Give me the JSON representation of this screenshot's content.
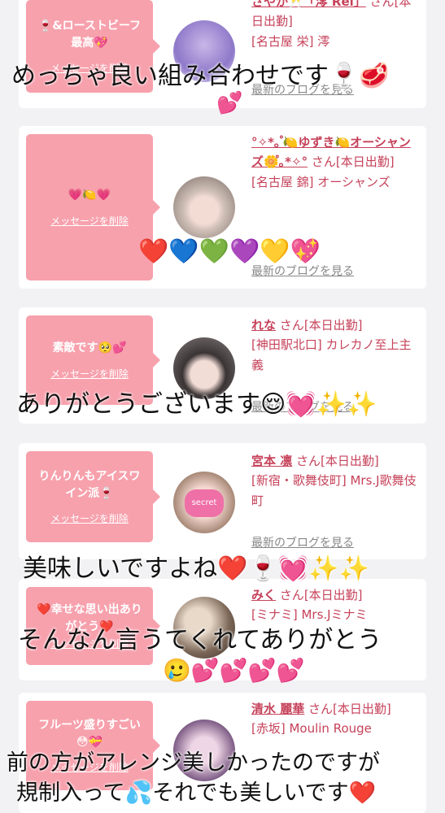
{
  "cards": [
    {
      "message": "🍷&ローストビーフ最高💖",
      "delete_label": "メッセージを削除",
      "name": "さやか🥂「澪 Rei」",
      "san": "さん",
      "status": "[本日出勤]",
      "shop": "[名古屋 栄] 澪",
      "blog_label": "最新のブログを見る"
    },
    {
      "message": "💗🍋💗",
      "delete_label": "メッセージを削除",
      "name": "°✧*｡ ゚🍋ゆずき🍋オーシャンズ🌼゚｡*✧°",
      "san": "さん",
      "status": "[本日出勤]",
      "shop": "[名古屋 錦] オーシャンズ",
      "blog_label": "最新のブログを見る"
    },
    {
      "message": "素敵です🥺💕",
      "delete_label": "メッセージを削除",
      "name": "れな",
      "san": "さん",
      "status": "[本日出勤]",
      "shop": "[神田駅北口] カレカノ至上主義",
      "blog_label": "最新のブログを見る"
    },
    {
      "message": "りんりんもアイスワイン派🍷",
      "delete_label": "メッセージを削除",
      "name": "宮本 凛",
      "san": "さん",
      "status": "[本日出勤]",
      "shop": "[新宿・歌舞伎町] Mrs.J歌舞伎町",
      "avatar_text": "secret",
      "blog_label": "最新のブログを見る"
    },
    {
      "message": "❤️幸せな思い出ありがとう❤️",
      "delete_label": "メッセージを削除",
      "name": "みく",
      "san": "さん",
      "status": "[本日出勤]",
      "shop": "[ミナミ] Mrs.Jミナミ",
      "blog_label": "最新のブログを見る"
    },
    {
      "message": "フルーツ盛りすごい😳💝",
      "delete_label": "メッセージを削除",
      "name": "清水 麗華",
      "san": "さん",
      "status": "[本日出勤]",
      "shop": "[赤坂] Moulin Rouge"
    }
  ],
  "overlays": {
    "o1": "めっちゃ良い組み合わせです🍷🥩",
    "o1b": "💕",
    "o2": "❤️💙💚💜💛💖",
    "o3": "ありがとうございます😌💓✨✨",
    "o4": "美味しいですよね❤️🍷💓✨✨",
    "o5": "そんなん言うてくれてありがとう",
    "o5b": "🥲💕💕💕💕",
    "o6": "前の方がアレンジ美しかったのですが",
    "o7": "規制入って💦それでも美しいです❤️"
  },
  "colors": {
    "bubble": "#f7a1ad",
    "name": "#c6425a",
    "background": "#f2f2f4"
  }
}
